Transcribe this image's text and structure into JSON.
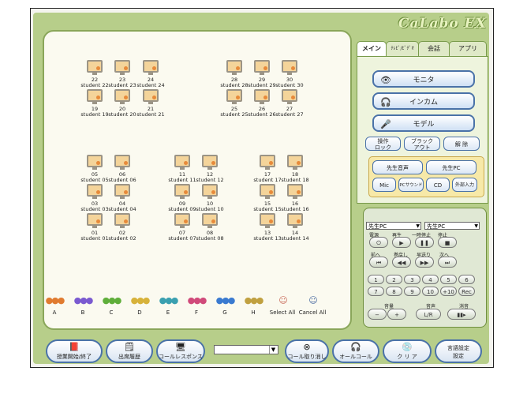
{
  "app": {
    "logo": "CaLabo EX"
  },
  "tabs": [
    "メイン",
    "ﾃﾚﾋﾞ/ﾋﾞﾃﾞｵ",
    "会話",
    "アプリ"
  ],
  "main_buttons": [
    {
      "label": "モニタ",
      "icon": "eye-icon"
    },
    {
      "label": "インカム",
      "icon": "headset-icon"
    },
    {
      "label": "モデル",
      "icon": "model-icon"
    }
  ],
  "small_buttons": [
    {
      "label": "操作\nロック",
      "icon": "lock-icon"
    },
    {
      "label": "ブラック\nアウト",
      "icon": "blackout-icon"
    },
    {
      "label": "解 除",
      "icon": "unlock-icon"
    }
  ],
  "sub_buttons": [
    {
      "label": "先生音声",
      "icon": "mic-icon"
    },
    {
      "label": "先生PC",
      "icon": "pc-icon"
    },
    {
      "label": "Mic",
      "icon": "mic-icon"
    },
    {
      "label": "PCサウンド",
      "icon": "speaker-icon"
    },
    {
      "label": "CD",
      "icon": "cd-icon"
    },
    {
      "label": "外部入力",
      "icon": "input-icon"
    }
  ],
  "player": {
    "source_left": "先生PC",
    "source_right": "先生PC",
    "transport_labels": [
      "電源",
      "再生",
      "一時停止",
      "停止"
    ],
    "transport2_labels": [
      "前へ",
      "巻戻し",
      "早送り",
      "次へ"
    ],
    "numbers": [
      "1",
      "2",
      "3",
      "4",
      "5",
      "6",
      "7",
      "8",
      "9",
      "10",
      "+10",
      "Rec"
    ],
    "volume_label": "音量",
    "audio_label": "音声",
    "mute_label": "消音",
    "minus": "−",
    "plus": "+",
    "lr": "L/R"
  },
  "seats": [
    {
      "num": "22",
      "name": "student 22"
    },
    {
      "num": "23",
      "name": "student 23"
    },
    {
      "num": "24",
      "name": "student 24"
    },
    {
      "num": "19",
      "name": "student 19"
    },
    {
      "num": "20",
      "name": "student 20"
    },
    {
      "num": "21",
      "name": "student 21"
    },
    {
      "num": "28",
      "name": "student 28"
    },
    {
      "num": "29",
      "name": "student 29"
    },
    {
      "num": "30",
      "name": "student 30"
    },
    {
      "num": "25",
      "name": "student 25"
    },
    {
      "num": "26",
      "name": "student 26"
    },
    {
      "num": "27",
      "name": "student 27"
    },
    {
      "num": "05",
      "name": "student 05"
    },
    {
      "num": "06",
      "name": "student 06"
    },
    {
      "num": "03",
      "name": "student 03"
    },
    {
      "num": "04",
      "name": "student 04"
    },
    {
      "num": "01",
      "name": "student 01"
    },
    {
      "num": "02",
      "name": "student 02"
    },
    {
      "num": "11",
      "name": "student 11"
    },
    {
      "num": "12",
      "name": "student 12"
    },
    {
      "num": "09",
      "name": "student 09"
    },
    {
      "num": "10",
      "name": "student 10"
    },
    {
      "num": "07",
      "name": "student 07"
    },
    {
      "num": "08",
      "name": "student 08"
    },
    {
      "num": "17",
      "name": "student 17"
    },
    {
      "num": "18",
      "name": "student 18"
    },
    {
      "num": "15",
      "name": "student 15"
    },
    {
      "num": "16",
      "name": "student 16"
    },
    {
      "num": "13",
      "name": "student 13"
    },
    {
      "num": "14",
      "name": "student 14"
    }
  ],
  "groups": [
    "A",
    "B",
    "C",
    "D",
    "E",
    "F",
    "G",
    "H",
    "Select All",
    "Cancel All"
  ],
  "bottom_buttons": [
    {
      "label": "授業開始/終了",
      "icon": "book-icon"
    },
    {
      "label": "出席履歴",
      "icon": "history-icon"
    },
    {
      "label": "コールレスポンス",
      "icon": "call-response-icon"
    },
    {
      "label": "コール取り消し",
      "icon": "cancel-call-icon"
    },
    {
      "label": "オールコール",
      "icon": "all-call-icon"
    },
    {
      "label": "ク リ ア",
      "icon": "clear-icon"
    },
    {
      "label": "言語設定\n設定",
      "icon": "settings-icon"
    }
  ],
  "colors": {
    "app_bg": "#b7ce8a",
    "panel_bg": "#fbfaf0",
    "button_border": "#4a72a8"
  }
}
